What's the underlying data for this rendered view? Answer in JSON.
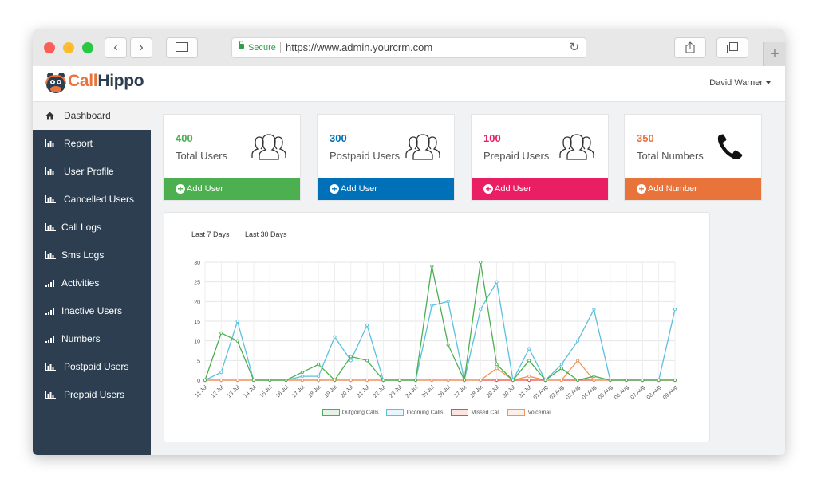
{
  "browser": {
    "secure_label": "Secure",
    "url": "https://www.admin.yourcrm.com",
    "back_glyph": "‹",
    "forward_glyph": "›",
    "reload_glyph": "↻",
    "new_tab_glyph": "+",
    "icons": [
      "sidebar-toggle-icon",
      "share-icon",
      "tabs-icon",
      "lock-icon"
    ]
  },
  "app": {
    "logo_part1": "Call",
    "logo_part2": "Hippo",
    "user_name": "David Warner",
    "brand_color": "#e8733b"
  },
  "sidebar": {
    "items": [
      {
        "label": "Dashboard",
        "icon": "home-icon"
      },
      {
        "label": "Report",
        "icon": "bar-chart-icon"
      },
      {
        "label": "User Profile",
        "icon": "bar-chart-icon"
      },
      {
        "label": "Cancelled Users",
        "icon": "bar-chart-icon"
      },
      {
        "label": "Call Logs",
        "icon": "bar-chart-icon"
      },
      {
        "label": "Sms Logs",
        "icon": "bar-chart-icon"
      },
      {
        "label": "Activities",
        "icon": "signal-icon"
      },
      {
        "label": "Inactive Users",
        "icon": "signal-icon"
      },
      {
        "label": "Numbers",
        "icon": "signal-icon"
      },
      {
        "label": "Postpaid Users",
        "icon": "bar-chart-icon"
      },
      {
        "label": "Prepaid Users",
        "icon": "bar-chart-icon"
      }
    ]
  },
  "cards": [
    {
      "value": "400",
      "label": "Total Users",
      "action": "Add User",
      "color": "#4caf50",
      "icon": "users-icon"
    },
    {
      "value": "300",
      "label": "Postpaid Users",
      "action": "Add User",
      "color": "#0071b9",
      "icon": "users-icon"
    },
    {
      "value": "100",
      "label": "Prepaid Users",
      "action": "Add User",
      "color": "#e91e63",
      "icon": "users-icon"
    },
    {
      "value": "350",
      "label": "Total Numbers",
      "action": "Add Number",
      "color": "#e8733b",
      "icon": "phone-icon"
    }
  ],
  "tabs": [
    {
      "label": "Last 7 Days"
    },
    {
      "label": "Last 30 Days"
    }
  ],
  "chart_data": {
    "type": "line",
    "categories": [
      "11 Jul",
      "12 Jul",
      "13 Jul",
      "14 Jul",
      "15 Jul",
      "16 Jul",
      "17 Jul",
      "18 Jul",
      "19 Jul",
      "20 Jul",
      "21 Jul",
      "22 Jul",
      "23 Jul",
      "24 Jul",
      "25 Jul",
      "26 Jul",
      "27 Jul",
      "28 Jul",
      "29 Jul",
      "30 Jul",
      "31 Jul",
      "01 Aug",
      "02 Aug",
      "03 Aug",
      "04 Aug",
      "05 Aug",
      "06 Aug",
      "07 Aug",
      "08 Aug",
      "09 Aug"
    ],
    "yticks": [
      "0",
      "5",
      "10",
      "15",
      "20",
      "25",
      "30"
    ],
    "ylim": [
      0,
      30
    ],
    "grid": true,
    "legend_position": "bottom",
    "series": [
      {
        "name": "Outgoing Calls",
        "color": "#4caf50",
        "values": [
          0,
          12,
          10,
          0,
          0,
          0,
          2,
          4,
          0,
          6,
          5,
          0,
          0,
          0,
          29,
          9,
          0,
          30,
          4,
          0,
          5,
          0,
          3,
          0,
          1,
          0,
          0,
          0,
          0,
          0
        ]
      },
      {
        "name": "Incoming Calls",
        "color": "#5bc0de",
        "values": [
          0,
          2,
          15,
          0,
          0,
          0,
          1,
          1,
          11,
          5,
          14,
          0,
          0,
          0,
          19,
          20,
          0,
          18,
          25,
          0,
          8,
          0,
          4,
          10,
          18,
          0,
          0,
          0,
          0,
          18
        ]
      },
      {
        "name": "Missed Call",
        "color": "#e74c3c",
        "values": [
          0,
          0,
          0,
          0,
          0,
          0,
          0,
          0,
          0,
          0,
          0,
          0,
          0,
          0,
          0,
          0,
          0,
          0,
          0,
          0,
          0,
          0,
          0,
          0,
          0,
          0,
          0,
          0,
          0,
          0
        ]
      },
      {
        "name": "Voicemail",
        "color": "#f0955a",
        "values": [
          0,
          0,
          0,
          0,
          0,
          0,
          0,
          0,
          0,
          0,
          0,
          0,
          0,
          0,
          0,
          0,
          0,
          0,
          3,
          0,
          1,
          0,
          0,
          5,
          0,
          0,
          0,
          0,
          0,
          0
        ]
      }
    ]
  }
}
